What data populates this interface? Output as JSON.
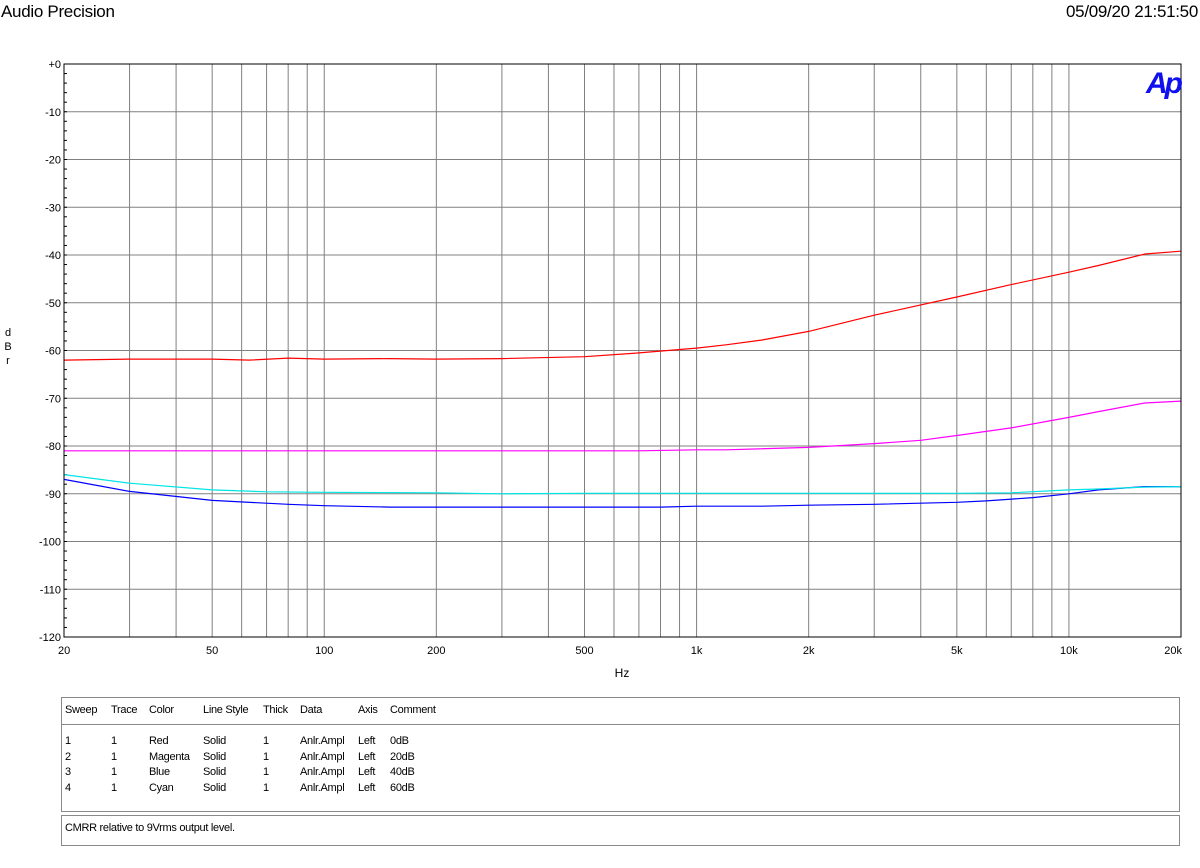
{
  "header": {
    "app_title": "Audio Precision",
    "timestamp": "05/09/20 21:51:50",
    "logo_text": "Ap"
  },
  "chart_data": {
    "type": "line",
    "xlabel": "Hz",
    "ylabel": "dBr",
    "xscale": "log",
    "xlim": [
      20,
      20000
    ],
    "ylim": [
      -120,
      0
    ],
    "grid": true,
    "x_ticks": [
      {
        "v": 20,
        "label": "20"
      },
      {
        "v": 50,
        "label": "50"
      },
      {
        "v": 100,
        "label": "100"
      },
      {
        "v": 200,
        "label": "200"
      },
      {
        "v": 500,
        "label": "500"
      },
      {
        "v": 1000,
        "label": "1k"
      },
      {
        "v": 2000,
        "label": "2k"
      },
      {
        "v": 5000,
        "label": "5k"
      },
      {
        "v": 10000,
        "label": "10k"
      },
      {
        "v": 20000,
        "label": "20k"
      }
    ],
    "y_ticks": [
      {
        "v": 0,
        "label": "+0"
      },
      {
        "v": -10,
        "label": "-10"
      },
      {
        "v": -20,
        "label": "-20"
      },
      {
        "v": -30,
        "label": "-30"
      },
      {
        "v": -40,
        "label": "-40"
      },
      {
        "v": -50,
        "label": "-50"
      },
      {
        "v": -60,
        "label": "-60"
      },
      {
        "v": -70,
        "label": "-70"
      },
      {
        "v": -80,
        "label": "-80"
      },
      {
        "v": -90,
        "label": "-90"
      },
      {
        "v": -100,
        "label": "-100"
      },
      {
        "v": -110,
        "label": "-110"
      },
      {
        "v": -120,
        "label": "-120"
      }
    ],
    "series": [
      {
        "name": "0dB",
        "color": "#ff0000",
        "x": [
          20,
          30,
          50,
          63,
          80,
          100,
          150,
          200,
          300,
          500,
          700,
          1000,
          1200,
          1500,
          2000,
          3000,
          5000,
          7000,
          10000,
          12000,
          16000,
          20000
        ],
        "y": [
          -62,
          -61.8,
          -61.8,
          -62,
          -61.6,
          -61.8,
          -61.7,
          -61.8,
          -61.7,
          -61.3,
          -60.5,
          -59.5,
          -58.8,
          -57.8,
          -56,
          -52.6,
          -48.8,
          -46.2,
          -43.6,
          -42.2,
          -39.8,
          -39.2
        ]
      },
      {
        "name": "20dB",
        "color": "#ff00ff",
        "x": [
          20,
          50,
          100,
          200,
          500,
          700,
          1000,
          1200,
          2000,
          3000,
          4000,
          5000,
          7000,
          10000,
          12000,
          16000,
          20000
        ],
        "y": [
          -81,
          -81,
          -81,
          -81,
          -81,
          -81,
          -80.8,
          -80.8,
          -80.3,
          -79.5,
          -78.8,
          -77.8,
          -76.2,
          -74,
          -72.8,
          -71,
          -70.6
        ]
      },
      {
        "name": "40dB",
        "color": "#0000ff",
        "x": [
          20,
          30,
          50,
          80,
          100,
          150,
          200,
          300,
          500,
          800,
          1000,
          1500,
          2000,
          3000,
          5000,
          6000,
          8000,
          10000,
          12000,
          16000,
          20000
        ],
        "y": [
          -87,
          -89.5,
          -91.4,
          -92.2,
          -92.5,
          -92.8,
          -92.8,
          -92.8,
          -92.8,
          -92.8,
          -92.6,
          -92.6,
          -92.4,
          -92.2,
          -91.8,
          -91.5,
          -90.8,
          -90,
          -89.2,
          -88.5,
          -88.5
        ]
      },
      {
        "name": "60dB",
        "color": "#00e5e5",
        "x": [
          20,
          30,
          50,
          70,
          100,
          200,
          300,
          500,
          1000,
          2000,
          5000,
          7000,
          10000,
          12000,
          16000,
          20000
        ],
        "y": [
          -86,
          -87.8,
          -89.2,
          -89.6,
          -89.7,
          -89.8,
          -90,
          -89.9,
          -89.9,
          -89.9,
          -89.9,
          -89.8,
          -89.2,
          -89,
          -88.6,
          -88.5
        ]
      }
    ]
  },
  "sweep_table": {
    "headers": [
      "Sweep",
      "Trace",
      "Color",
      "Line Style",
      "Thick",
      "Data",
      "Axis",
      "Comment"
    ],
    "rows": [
      [
        "1",
        "1",
        "Red",
        "Solid",
        "1",
        "Anlr.Ampl",
        "Left",
        "0dB"
      ],
      [
        "2",
        "1",
        "Magenta",
        "Solid",
        "1",
        "Anlr.Ampl",
        "Left",
        "20dB"
      ],
      [
        "3",
        "1",
        "Blue",
        "Solid",
        "1",
        "Anlr.Ampl",
        "Left",
        "40dB"
      ],
      [
        "4",
        "1",
        "Cyan",
        "Solid",
        "1",
        "Anlr.Ampl",
        "Left",
        "60dB"
      ]
    ]
  },
  "comment": "CMRR relative to 9Vrms output level."
}
